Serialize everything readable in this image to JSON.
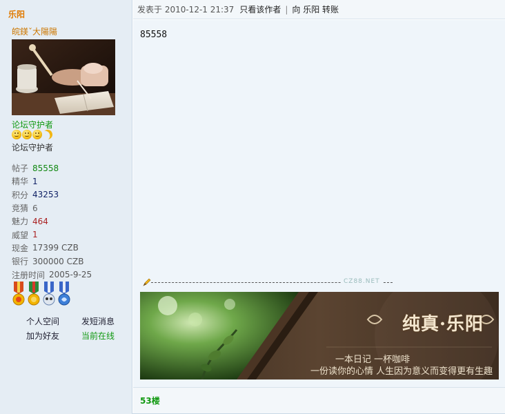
{
  "author": {
    "name": "乐阳",
    "nickname": "皖鎂ˇ大陽陽",
    "rank_title": "论坛守护者",
    "group": "论坛守护者",
    "stats": [
      {
        "key": "帖子",
        "value": "85558",
        "color": "#118811"
      },
      {
        "key": "精华",
        "value": "1",
        "color": "#112266"
      },
      {
        "key": "积分",
        "value": "43253",
        "color": "#112266"
      },
      {
        "key": "竞猜",
        "value": "6",
        "color": "#666666"
      },
      {
        "key": "魅力",
        "value": "464",
        "color": "#aa2222"
      },
      {
        "key": "威望",
        "value": "1",
        "color": "#aa2222"
      },
      {
        "key": "现金",
        "value": "17399 CZB",
        "color": "#555555"
      },
      {
        "key": "银行",
        "value": "300000 CZB",
        "color": "#555555"
      },
      {
        "key": "注册时间",
        "value": "2005-9-25",
        "color": "#555555"
      }
    ],
    "star_icons": [
      "smiley-sun-icon",
      "smiley-sun-icon",
      "smiley-sun-icon",
      "moon-icon"
    ],
    "medal_icons": [
      "gold-medal-icon",
      "gold-medal-icon",
      "blue-medal-icon",
      "blue-medal-icon"
    ],
    "links": {
      "space": "个人空间",
      "message": "发短消息",
      "add_friend": "加为好友",
      "online": "当前在线"
    }
  },
  "post": {
    "posted_label": "发表于 2010-12-1 21:37",
    "only_author": "只看该作者",
    "separator": "|",
    "transfer": "向 乐阳 转账",
    "body": "85558",
    "floor": "53楼"
  },
  "signature": {
    "watermark": "CZ88.NET",
    "title": "纯真·乐阳",
    "line1": "一本日记    一杯咖啡",
    "line2": "一份读你的心情 人生因为意义而变得更有生趣"
  },
  "colors": {
    "sidebar_bg": "#e5edf4",
    "content_bg": "#eff5fa",
    "accent_orange": "#e07a00",
    "online_green": "#119911"
  }
}
